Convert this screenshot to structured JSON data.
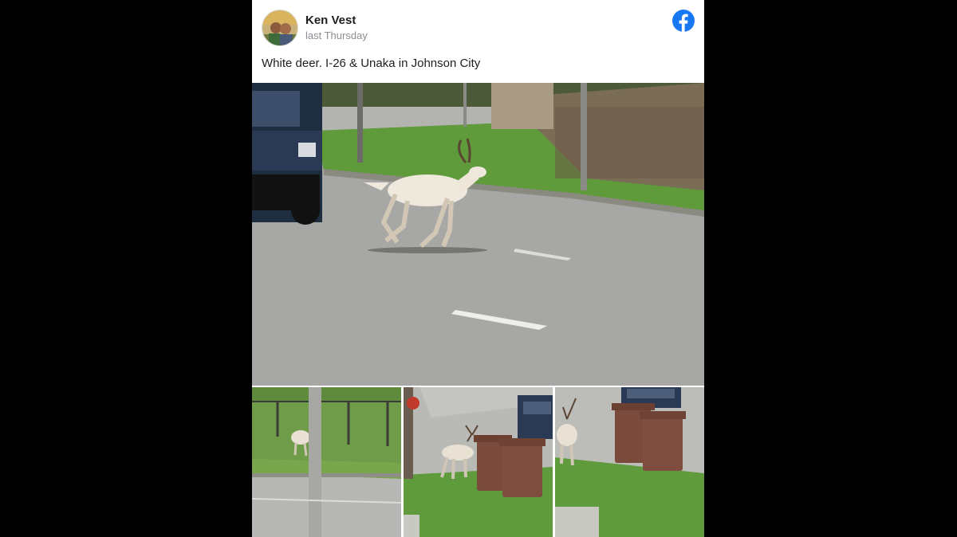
{
  "post": {
    "author": "Ken Vest",
    "timestamp": "last Thursday",
    "caption": "White deer. I-26 & Unaka in Johnson City"
  },
  "icons": {
    "platform": "facebook-icon",
    "avatar": "profile-photo"
  },
  "colors": {
    "facebook_blue": "#1877F2",
    "text_primary": "#1c1e21",
    "text_secondary": "#8a8d91"
  },
  "photos": [
    {
      "description": "white deer running across road"
    },
    {
      "description": "white deer near fence"
    },
    {
      "description": "white deer beside trash bins"
    },
    {
      "description": "white deer next to bins and truck"
    }
  ]
}
